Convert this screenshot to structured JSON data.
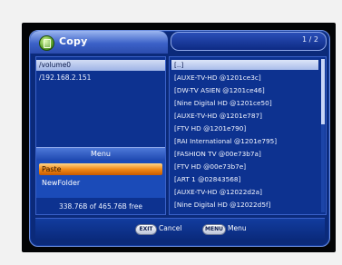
{
  "window": {
    "title": "Copy",
    "page": "1 / 2",
    "icon": "copy-icon"
  },
  "left_pane": {
    "selected_folder": "/volume0",
    "network_path": "/192.168.2.151",
    "free_space": "338.76B of 465.76B free"
  },
  "menu": {
    "title": "Menu",
    "items": [
      {
        "label": "Paste",
        "active": true
      },
      {
        "label": "NewFolder",
        "active": false
      }
    ]
  },
  "file_list": [
    "[..]",
    "[AUXE-TV-HD @1201ce3c]",
    "[DW-TV ASIEN @1201ce46]",
    "[Nine Digital HD @1201ce50]",
    "[AUXE-TV-HD @1201e787]",
    "[FTV HD @1201e790]",
    "[RAI International @1201e795]",
    "[FASHION TV @00e73b7a]",
    "[FTV HD @00e73b7e]",
    "[ART 1 @02843568]",
    "[AUXE-TV-HD @12022d2a]",
    "[Nine Digital HD @12022d5f]"
  ],
  "bottom_bar": {
    "exit_key": "EXIT",
    "cancel_label": "Cancel",
    "menu_key": "MENU",
    "menu_label": "Menu"
  }
}
